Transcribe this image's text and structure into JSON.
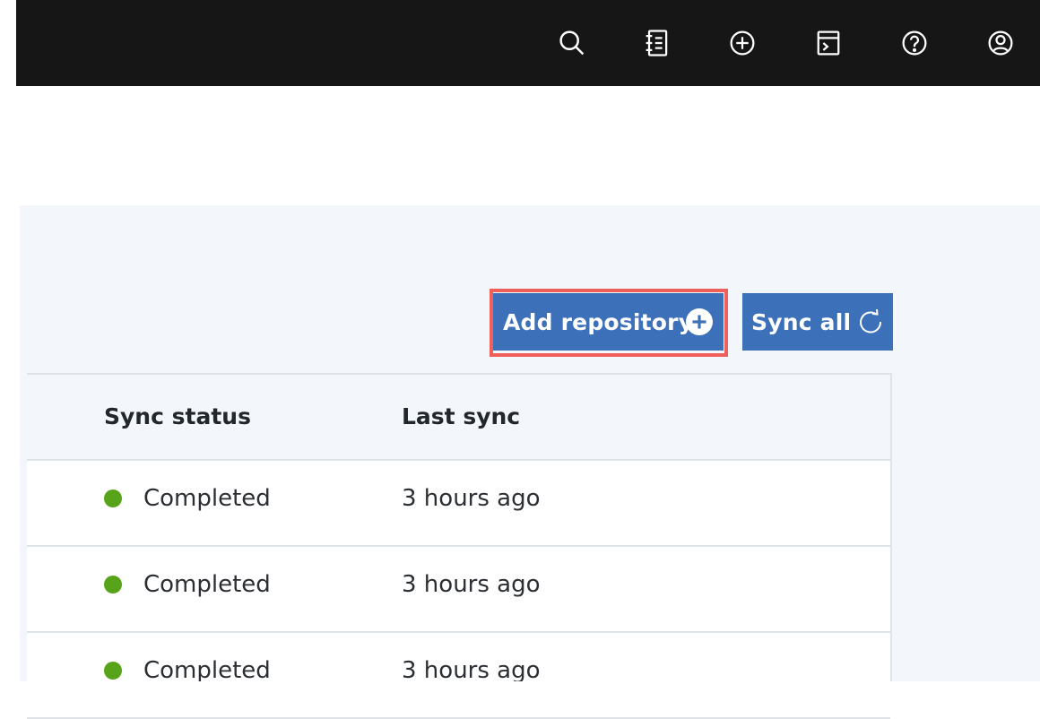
{
  "header": {
    "icons": [
      {
        "name": "search-icon"
      },
      {
        "name": "notebook-icon"
      },
      {
        "name": "add-icon"
      },
      {
        "name": "terminal-icon"
      },
      {
        "name": "help-icon"
      },
      {
        "name": "user-avatar-icon"
      }
    ]
  },
  "toolbar": {
    "add_repository_label": "Add repository",
    "sync_all_label": "Sync all"
  },
  "table": {
    "columns": [
      "Sync status",
      "Last sync"
    ],
    "rows": [
      {
        "status": "Completed",
        "last_sync": "3 hours ago"
      },
      {
        "status": "Completed",
        "last_sync": "3 hours ago"
      },
      {
        "status": "Completed",
        "last_sync": "3 hours ago"
      }
    ]
  },
  "colors": {
    "header_bg": "#161616",
    "primary_button": "#3c70b8",
    "highlight": "#f0605a",
    "status_completed": "#57a31a"
  }
}
